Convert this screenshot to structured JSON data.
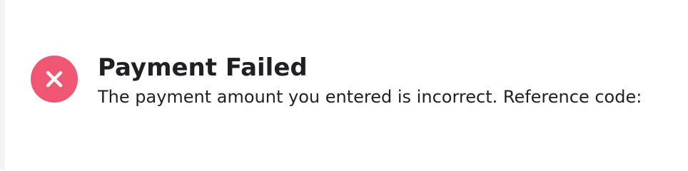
{
  "notice": {
    "status": "error",
    "title": "Payment Failed",
    "message": "The payment amount you entered is incorrect. Reference code:",
    "icon": "close-icon",
    "accent_color": "#ef5672"
  }
}
